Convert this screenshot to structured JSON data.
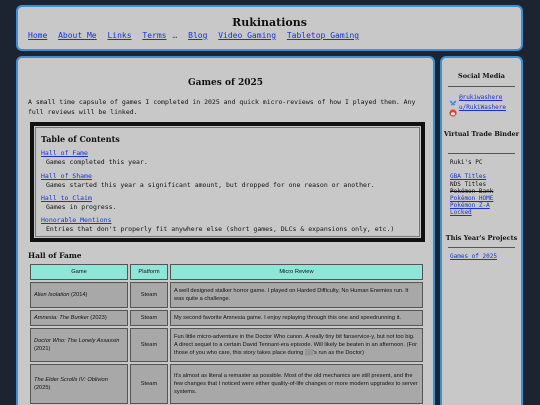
{
  "site": {
    "title": "Rukinations"
  },
  "nav": [
    "Home",
    "About Me",
    "Links",
    "Terms",
    "Blog",
    "Video Gaming",
    "Tabletop Gaming"
  ],
  "nav_separator": "…",
  "main": {
    "title": "Games of 2025",
    "intro": "A small time capsule of games I completed in 2025 and quick micro-reviews of how I played them. Any full reviews will be linked."
  },
  "toc": {
    "heading": "Table of Contents",
    "items": [
      {
        "link": "Hall of Fame",
        "desc": "Games completed this year."
      },
      {
        "link": "Hall of Shame",
        "desc": "Games started this year a significant amount, but dropped for one reason or another."
      },
      {
        "link": "Hall to Claim",
        "desc": "Games in progress."
      },
      {
        "link": "Honorable Mentions",
        "desc": "Entries that don't properly fit anywhere else (short games, DLCs & expansions only, etc.)"
      }
    ]
  },
  "hall_of_fame": {
    "heading": "Hall of Fame",
    "columns": [
      "Game",
      "Platform",
      "Micro Review"
    ],
    "rows": [
      {
        "game": "Alien Isolation",
        "year": "(2014)",
        "platform": "Steam",
        "review": "A well designed stalker horror game. I played on Harded Difficulty, No Human Enemies run. It was quite a challenge."
      },
      {
        "game": "Amnesia: The Bunker",
        "year": "(2023)",
        "platform": "Steam",
        "review": "My second favorite Amnesia game. I enjoy replaying through this one and speedrunning it."
      },
      {
        "game": "Doctor Who: The Lonely Assassin",
        "year": "(2021)",
        "platform": "Steam",
        "review": "Fun little micro-adventure in the Doctor Who canon. A really tiny bit fanservice-y, but not too big. A direct sequel to a certain David Tennant-era episode. Will likely be beaten in an afternoon. (For those of you who care, this story takes place during ░░'s run as the Doctor)"
      },
      {
        "game": "The Elder Scrolls IV: Oblivion",
        "year": "(2025)",
        "platform": "Steam",
        "review": "It's almost as literal a remaster as possible. Most of the old mechanics are still present, and the few changes that I noticed were either quality-of-life changes or more modern upgrades to server systems."
      }
    ]
  },
  "sidebar": {
    "social_heading": "Social Media",
    "social": [
      "@rukiwashere",
      "u/RukiWashere"
    ],
    "binder_heading": "Virtual Trade Binder",
    "binder_owner": "Ruki's PC",
    "binder_items": [
      {
        "label": "GBA Titles",
        "link": true,
        "strike": false
      },
      {
        "label": "NDS Titles",
        "link": false,
        "strike": false
      },
      {
        "label": "Pokémon Bank",
        "link": false,
        "strike": true
      },
      {
        "label": "Pokémon HOME",
        "link": true,
        "strike": false
      },
      {
        "label": "Pokémon Z-A",
        "link": true,
        "strike": false
      },
      {
        "label": "Locked",
        "link": true,
        "strike": false
      }
    ],
    "projects_heading": "This Year's Projects",
    "projects": [
      "Games of 2025"
    ]
  },
  "colors": {
    "border": "#3a8fd6",
    "panel": "#c8c8c8",
    "table_header": "#8ee6d8",
    "link": "#1d2fd6"
  }
}
